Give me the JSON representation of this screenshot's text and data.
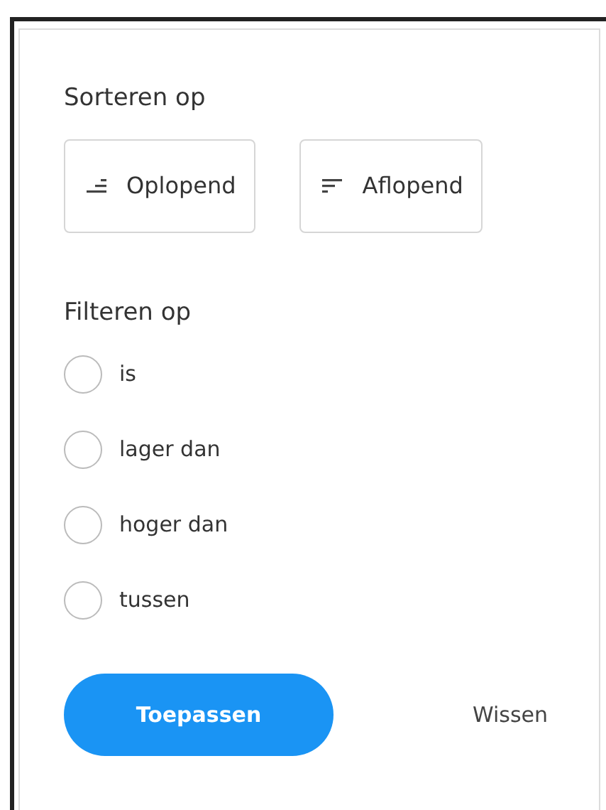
{
  "sort": {
    "title": "Sorteren op",
    "options": [
      {
        "kind": "ascending",
        "label": "Oplopend"
      },
      {
        "kind": "descending",
        "label": "Aflopend"
      }
    ]
  },
  "filter": {
    "title": "Filteren op",
    "options": [
      {
        "label": "is",
        "selected": false
      },
      {
        "label": "lager dan",
        "selected": false
      },
      {
        "label": "hoger dan",
        "selected": false
      },
      {
        "label": "tussen",
        "selected": false
      }
    ]
  },
  "actions": {
    "apply": "Toepassen",
    "clear": "Wissen"
  }
}
